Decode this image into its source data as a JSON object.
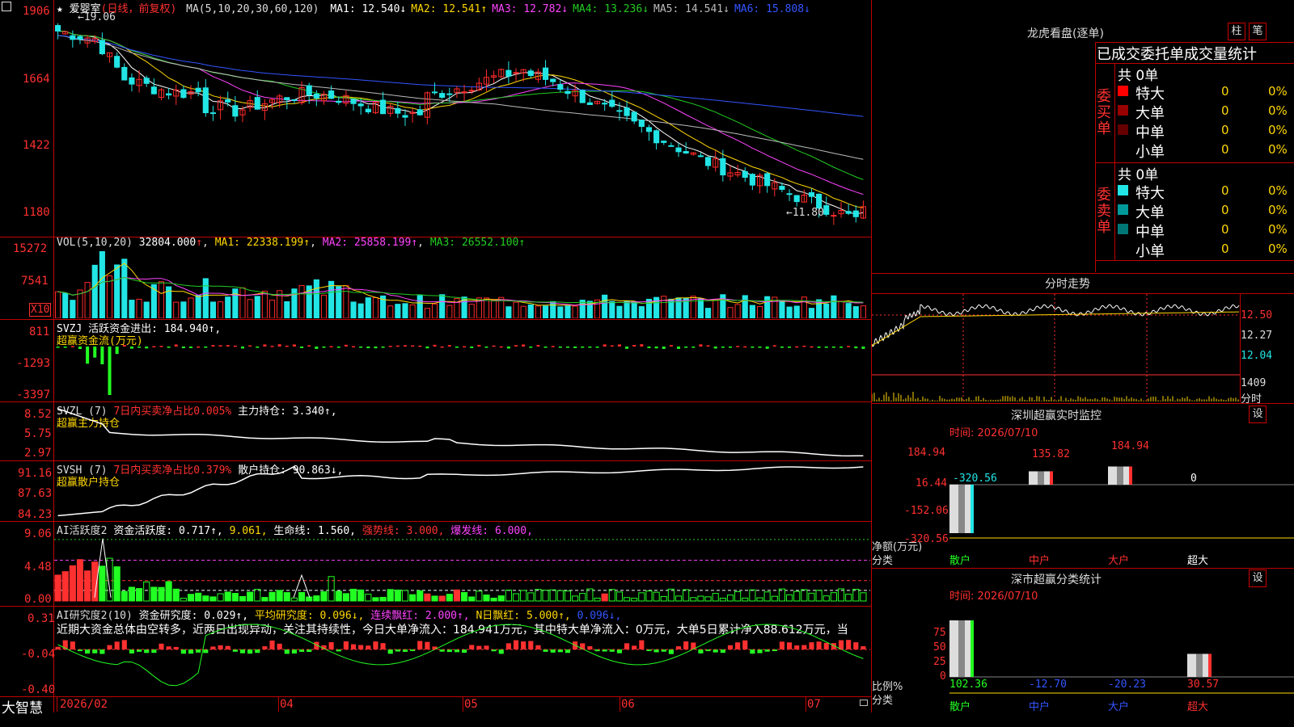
{
  "colors": {
    "up": "#ff2a2a",
    "down": "#22e5e5",
    "grid": "#c00000",
    "white": "#ffffff",
    "yellow": "#ffd700",
    "magenta": "#ff44ff",
    "green": "#22cc22",
    "blue": "#3355ff",
    "gray": "#bbbbbb",
    "cyan": "#22e5e5",
    "red": "#ff3030",
    "brightgreen": "#22ff22"
  },
  "price_panel": {
    "menu_icon": "menu-icon",
    "title": "★ 爱婴室",
    "period": "(日线，前复权)",
    "ma_label": "MA(5,10,20,30,60,120)",
    "ma": [
      {
        "name": "MA1:",
        "value": "12.540",
        "arrow": "↓",
        "color": "#ffffff"
      },
      {
        "name": "MA2:",
        "value": "12.541",
        "arrow": "↑",
        "color": "#ffd700"
      },
      {
        "name": "MA3:",
        "value": "12.782",
        "arrow": "↓",
        "color": "#ff44ff"
      },
      {
        "name": "MA4:",
        "value": "13.236",
        "arrow": "↓",
        "color": "#22cc22"
      },
      {
        "name": "MA5:",
        "value": "14.541",
        "arrow": "↓",
        "color": "#bbbbbb"
      },
      {
        "name": "MA6:",
        "value": "15.808",
        "arrow": "↓",
        "color": "#3355ff"
      }
    ],
    "y_ticks": [
      "1906",
      "1664",
      "1422",
      "1180"
    ],
    "high_label": "19.06",
    "low_label": "11.80",
    "date_labels": [
      "2026/02",
      "04",
      "05",
      "06",
      "07"
    ]
  },
  "vol_panel": {
    "label": "VOL(5,10,20)",
    "value": "32804.000",
    "arrow": "↑",
    "ma1": "MA1: 22338.199↑",
    "ma2": "MA2: 25858.199↑",
    "ma3": "MA3: 26552.100↑",
    "y_ticks": [
      "15272",
      "7541"
    ],
    "unit": "X10"
  },
  "svzj_panel": {
    "label": "SVZJ  活跃资金进出: 184.940↑,",
    "sub": "超赢资金流(万元)",
    "y_ticks": [
      "811",
      "-1293",
      "-3397"
    ]
  },
  "svzl_panel": {
    "label": "SVZL (7)",
    "red_text": "7日内买卖净占比0.005%",
    "white_text": "主力持仓: 3.340↑,",
    "sub": "超赢主力持仓",
    "y_ticks": [
      "8.52",
      "5.75",
      "2.97"
    ]
  },
  "svsh_panel": {
    "label": "SVSH (7)",
    "red_text": "7日内买卖净占比0.379%",
    "white_text": "散户持仓: 90.863↓,",
    "sub": "超赢散户持仓",
    "y_ticks": [
      "91.16",
      "87.63",
      "84.23"
    ]
  },
  "ai_panel": {
    "label": "AI活跃度2",
    "t1": "资金活跃度: 0.717↑,",
    "t2": "9.061,",
    "t3": "生命线: 1.560,",
    "t4": "强势线: 3.000,",
    "t5": "爆发线: 6.000,",
    "y_ticks": [
      "9.06",
      "4.48",
      "0.00"
    ]
  },
  "research_panel": {
    "label": "AI研究度2(10)",
    "t1": "资金研究度: 0.029↑,",
    "t2": "平均研究度: 0.096↓,",
    "t3": "连续飘红: 2.000↑,",
    "t4": "N日飘红: 5.000↑,",
    "t5": "0.096↓,",
    "comment": "近期大资金总体由空转多，近两日出现异动，关注其持续性，今日大单净流入：184.941万元，其中特大单净流入：0万元，大单5日累计净入88.612万元，当",
    "y_ticks": [
      "0.31",
      "-0.04",
      "-0.40"
    ]
  },
  "footer": {
    "brand": "大智慧"
  },
  "right": {
    "dragon_title": "龙虎看盘(逐单)",
    "btn_zhu": "柱",
    "btn_bi": "笔",
    "stats_title": "已成交委托单成交量统计",
    "buy": {
      "side": "委买单",
      "total": "共 0单",
      "rows": [
        {
          "name": "特大",
          "value": "0",
          "pct": "0%",
          "color": "#ff0000"
        },
        {
          "name": "大单",
          "value": "0",
          "pct": "0%",
          "color": "#990000"
        },
        {
          "name": "中单",
          "value": "0",
          "pct": "0%",
          "color": "#660000"
        },
        {
          "name": "小单",
          "value": "0",
          "pct": "0%",
          "color": ""
        }
      ]
    },
    "sell": {
      "side": "委卖单",
      "total": "共 0单",
      "rows": [
        {
          "name": "特大",
          "value": "0",
          "pct": "0%",
          "color": "#22e5e5"
        },
        {
          "name": "大单",
          "value": "0",
          "pct": "0%",
          "color": "#009999"
        },
        {
          "name": "中单",
          "value": "0",
          "pct": "0%",
          "color": "#007777"
        },
        {
          "name": "小单",
          "value": "0",
          "pct": "0%",
          "color": ""
        }
      ]
    },
    "intraday": {
      "title": "分时走势",
      "y_ticks": [
        "12.50",
        "12.27",
        "12.04"
      ],
      "vol_tick": "1409",
      "vol_unit": "分时"
    },
    "monitor": {
      "title": "深圳超赢实时监控",
      "btn": "设",
      "time": "时间: 2026/07/10",
      "y_ticks": [
        "184.94",
        "16.44",
        "-152.06",
        "-320.56"
      ],
      "values": [
        "-320.56",
        "135.82",
        "184.94",
        "0"
      ],
      "axis_label1": "净额(万元)",
      "axis_label2": "分类",
      "cats": [
        "散户",
        "中户",
        "大户",
        "超大"
      ]
    },
    "category": {
      "title": "深市超赢分类统计",
      "btn": "设",
      "time": "时间: 2026/07/10",
      "y_ticks": [
        "75",
        "50",
        "25",
        "0"
      ],
      "values": [
        "102.36",
        "-12.70",
        "-20.23",
        "30.57"
      ],
      "axis_label1": "比例%",
      "axis_label2": "分类",
      "cats": [
        "散户",
        "中户",
        "大户",
        "超大"
      ]
    }
  }
}
